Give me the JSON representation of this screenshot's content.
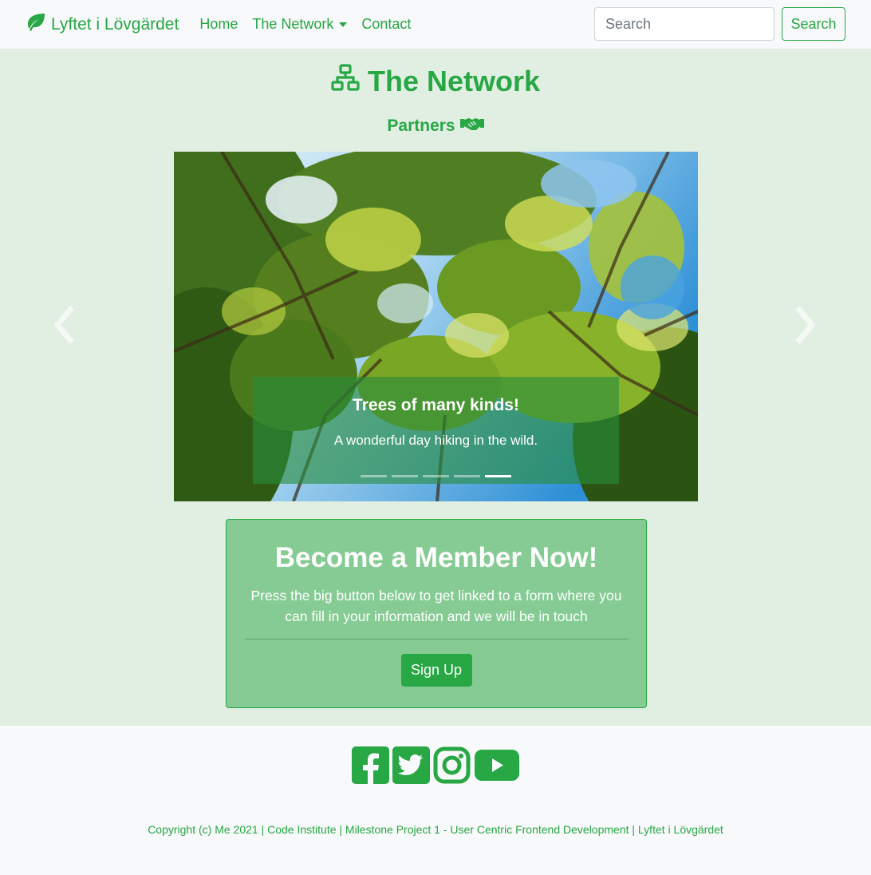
{
  "navbar": {
    "brand": "Lyftet i Lövgärdet",
    "brand_icon": "leaf-icon",
    "links": [
      "Home",
      "The Network",
      "Contact"
    ],
    "search_placeholder": "Search",
    "search_button": "Search"
  },
  "header": {
    "title": "The Network",
    "title_icon": "network-icon",
    "subtitle": "Partners",
    "subtitle_icon": "handshake-icon"
  },
  "carousel": {
    "caption_title": "Trees of many kinds!",
    "caption_text": "A wonderful day hiking in the wild.",
    "slide_count": 5,
    "active_index": 4
  },
  "member": {
    "title": "Become a Member Now!",
    "text": "Press the big button below to get linked to a form where you can fill in your information and we will be in touch",
    "button": "Sign Up"
  },
  "footer": {
    "social_icons": [
      "facebook-icon",
      "twitter-icon",
      "instagram-icon",
      "youtube-icon"
    ],
    "copyright": "Copyright (c) Me 2021 | Code Institute | Milestone Project 1 - User Centric Frontend Development | Lyftet i Lövgärdet"
  },
  "colors": {
    "accent": "#28a745",
    "main_bg": "#e1efe3",
    "card_bg": "#85cb93",
    "navbar_bg": "#f8f9fa"
  }
}
